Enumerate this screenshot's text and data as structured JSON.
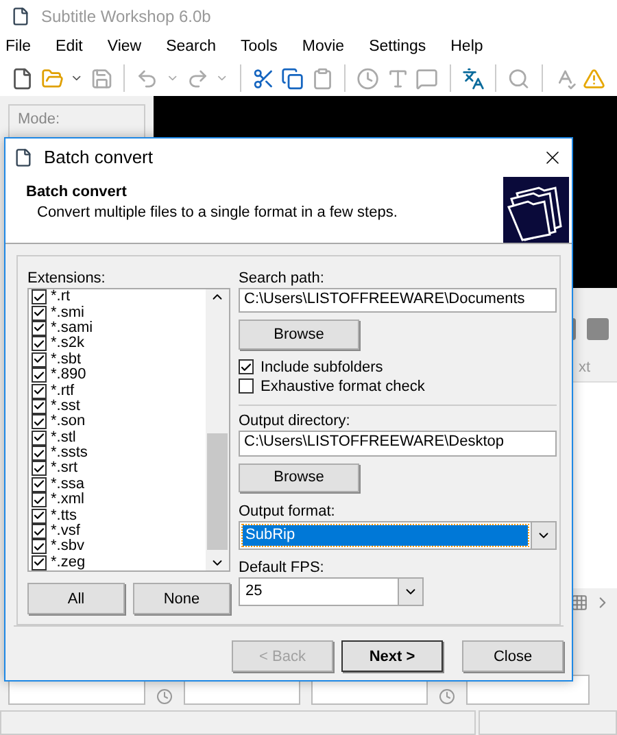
{
  "window": {
    "title": "Subtitle Workshop 6.0b"
  },
  "menu": [
    "File",
    "Edit",
    "View",
    "Search",
    "Tools",
    "Movie",
    "Settings",
    "Help"
  ],
  "toolbar": [
    {
      "kind": "new",
      "disabled": false
    },
    {
      "kind": "open",
      "disabled": false
    },
    {
      "kind": "caret",
      "disabled": false
    },
    {
      "kind": "save",
      "disabled": true
    },
    {
      "kind": "sep"
    },
    {
      "kind": "undo",
      "disabled": true
    },
    {
      "kind": "caret",
      "disabled": true
    },
    {
      "kind": "redo",
      "disabled": true
    },
    {
      "kind": "caret",
      "disabled": true
    },
    {
      "kind": "sep"
    },
    {
      "kind": "cut",
      "disabled": false
    },
    {
      "kind": "copy",
      "disabled": false
    },
    {
      "kind": "paste",
      "disabled": true
    },
    {
      "kind": "sep"
    },
    {
      "kind": "clock",
      "disabled": true
    },
    {
      "kind": "text",
      "disabled": true
    },
    {
      "kind": "comment",
      "disabled": true
    },
    {
      "kind": "sep"
    },
    {
      "kind": "translate",
      "disabled": false
    },
    {
      "kind": "sep"
    },
    {
      "kind": "search",
      "disabled": true
    },
    {
      "kind": "sep"
    },
    {
      "kind": "spell",
      "disabled": true
    },
    {
      "kind": "warning",
      "disabled": false
    }
  ],
  "mode_panel": {
    "label": "Mode:"
  },
  "subtitle_list": {
    "column_header": "xt"
  },
  "dialog": {
    "title": "Batch convert",
    "header": {
      "title": "Batch convert",
      "subtitle": "Convert multiple files to a single format in a few steps."
    },
    "extensions": {
      "label": "Extensions:",
      "items": [
        {
          "label": "*.rt",
          "checked": true
        },
        {
          "label": "*.smi",
          "checked": true
        },
        {
          "label": "*.sami",
          "checked": true
        },
        {
          "label": "*.s2k",
          "checked": true
        },
        {
          "label": "*.sbt",
          "checked": true
        },
        {
          "label": "*.890",
          "checked": true
        },
        {
          "label": "*.rtf",
          "checked": true
        },
        {
          "label": "*.sst",
          "checked": true
        },
        {
          "label": "*.son",
          "checked": true
        },
        {
          "label": "*.stl",
          "checked": true
        },
        {
          "label": "*.ssts",
          "checked": true
        },
        {
          "label": "*.srt",
          "checked": true
        },
        {
          "label": "*.ssa",
          "checked": true
        },
        {
          "label": "*.xml",
          "checked": true
        },
        {
          "label": "*.tts",
          "checked": true
        },
        {
          "label": "*.vsf",
          "checked": true
        },
        {
          "label": "*.sbv",
          "checked": true
        },
        {
          "label": "*.zeg",
          "checked": true
        }
      ]
    },
    "select_buttons": [
      "All",
      "None"
    ],
    "search_path": {
      "label": "Search path:",
      "value": "C:\\Users\\LISTOFFREEWARE\\Documents",
      "button": "Browse"
    },
    "options": [
      {
        "label": "Include subfolders",
        "checked": true
      },
      {
        "label": "Exhaustive format check",
        "checked": false
      }
    ],
    "output_directory": {
      "label": "Output directory:",
      "value": "C:\\Users\\LISTOFFREEWARE\\Desktop",
      "button": "Browse"
    },
    "output_format": {
      "label": "Output format:",
      "value": "SubRip"
    },
    "default_fps": {
      "label": "Default FPS:",
      "value": "25"
    },
    "buttons": [
      {
        "label": "< Back",
        "disabled": true,
        "default": false
      },
      {
        "label": "Next >",
        "disabled": false,
        "default": true
      },
      {
        "label": "Close",
        "disabled": false,
        "default": false
      }
    ]
  }
}
